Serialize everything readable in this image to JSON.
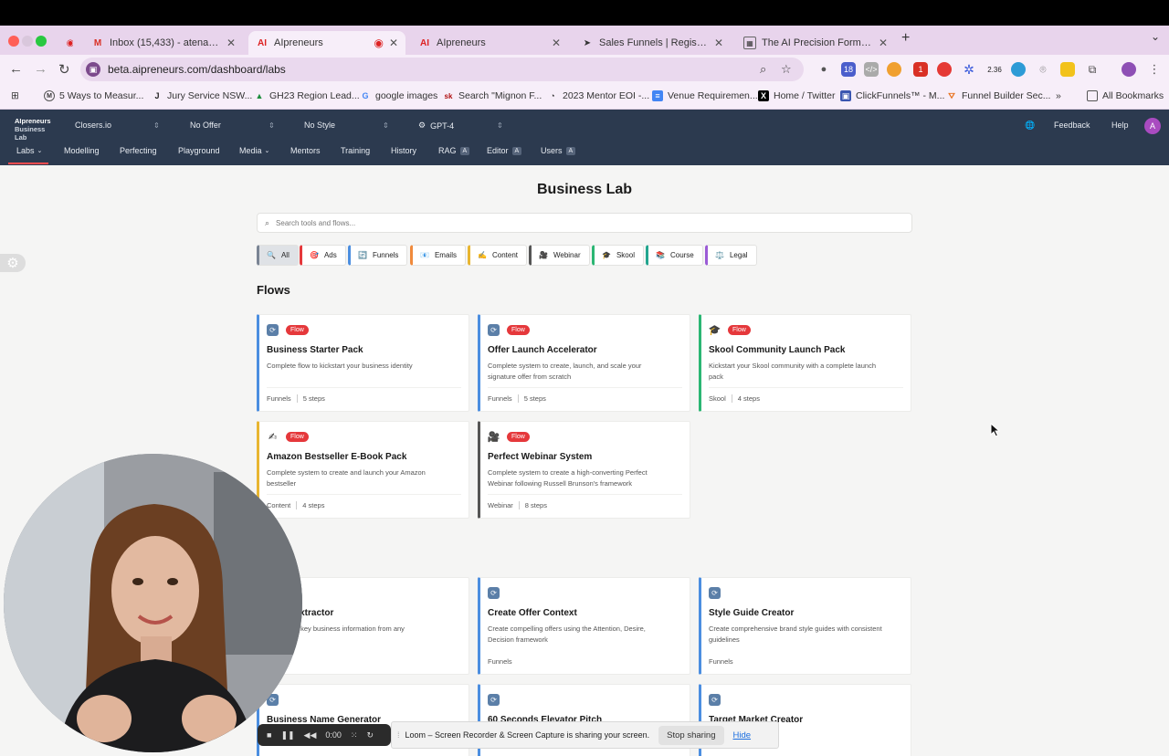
{
  "browser": {
    "tabs": [
      {
        "title": "Inbox (15,433) - atena@aten",
        "icon": "gmail-icon",
        "active": false
      },
      {
        "title": "AIpreneurs",
        "icon": "ai-icon",
        "active": true
      },
      {
        "title": "AIpreneurs",
        "icon": "ai-icon",
        "active": false
      },
      {
        "title": "Sales Funnels | Register For T",
        "icon": "cursor-icon",
        "active": false
      },
      {
        "title": "The AI Precision Formula - Fr",
        "icon": "page-icon",
        "active": false
      }
    ],
    "url": "beta.aipreneurs.com/dashboard/labs",
    "bookmarks": [
      "5 Ways to Measur...",
      "Jury Service NSW...",
      "GH23 Region Lead...",
      "google images",
      "Search \"Mignon F...",
      "2023 Mentor EOI -...",
      "Venue Requiremen...",
      "Home / Twitter",
      "ClickFunnels™ - M...",
      "Funnel Builder Sec..."
    ],
    "all_bookmarks": "All Bookmarks",
    "ext_badges": {
      "b1": "18",
      "b2": "1",
      "b3": "2.36"
    }
  },
  "app": {
    "logo_line1": "AIpreneurs",
    "logo_line2": "Business Lab",
    "selectors": [
      "Closers.io",
      "No Offer",
      "No Style",
      "GPT-4"
    ],
    "feedback": "Feedback",
    "help": "Help",
    "avatar": "A",
    "menu": [
      {
        "label": "Labs",
        "dropdown": true
      },
      {
        "label": "Modelling"
      },
      {
        "label": "Perfecting"
      },
      {
        "label": "Playground"
      },
      {
        "label": "Media",
        "dropdown": true
      },
      {
        "label": "Mentors"
      },
      {
        "label": "Training"
      },
      {
        "label": "History"
      },
      {
        "label": "RAG",
        "admin": "A"
      },
      {
        "label": "Editor",
        "admin": "A"
      },
      {
        "label": "Users",
        "admin": "A"
      }
    ]
  },
  "page": {
    "title": "Business Lab",
    "search_placeholder": "Search tools and flows...",
    "filters": [
      {
        "label": "All",
        "icon": "🔍",
        "color": "#7a8494"
      },
      {
        "label": "Ads",
        "icon": "🎯",
        "color": "#e5383b"
      },
      {
        "label": "Funnels",
        "icon": "🔄",
        "color": "#4b8ee0"
      },
      {
        "label": "Emails",
        "icon": "📧",
        "color": "#f08a3c"
      },
      {
        "label": "Content",
        "icon": "✍️",
        "color": "#e8b530"
      },
      {
        "label": "Webinar",
        "icon": "🎥",
        "color": "#555555"
      },
      {
        "label": "Skool",
        "icon": "🎓",
        "color": "#2bb673"
      },
      {
        "label": "Course",
        "icon": "📚",
        "color": "#23a58f"
      },
      {
        "label": "Legal",
        "icon": "⚖️",
        "color": "#9b5bd6"
      }
    ],
    "flows_heading": "Flows",
    "flow_badge": "Flow",
    "flows": [
      {
        "title": "Business Starter Pack",
        "desc": "Complete flow to kickstart your business identity",
        "category": "Funnels",
        "steps": "5 steps",
        "color": "#4b8ee0",
        "icon": "🔄"
      },
      {
        "title": "Offer Launch Accelerator",
        "desc": "Complete system to create, launch, and scale your signature offer from scratch",
        "category": "Funnels",
        "steps": "5 steps",
        "color": "#4b8ee0",
        "icon": "🔄"
      },
      {
        "title": "Skool Community Launch Pack",
        "desc": "Kickstart your Skool community with a complete launch pack",
        "category": "Skool",
        "steps": "4 steps",
        "color": "#2bb673",
        "icon": "🎓"
      },
      {
        "title": "Amazon Bestseller E-Book Pack",
        "desc": "Complete system to create and launch your Amazon bestseller",
        "category": "Content",
        "steps": "4 steps",
        "color": "#e8b530",
        "icon": "✍️"
      },
      {
        "title": "Perfect Webinar System",
        "desc": "Complete system to create a high-converting Perfect Webinar following Russell Brunson's framework",
        "category": "Webinar",
        "steps": "8 steps",
        "color": "#555555",
        "icon": "🎥"
      }
    ],
    "tools": [
      {
        "title": "s Info Extractor",
        "desc": "d organize key business information from any",
        "category": "",
        "color": "#4b8ee0"
      },
      {
        "title": "Create Offer Context",
        "desc": "Create compelling offers using the Attention, Desire, Decision framework",
        "category": "Funnels",
        "color": "#4b8ee0"
      },
      {
        "title": "Style Guide Creator",
        "desc": "Create comprehensive brand style guides with consistent guidelines",
        "category": "Funnels",
        "color": "#4b8ee0"
      },
      {
        "title": "Business Name Generator",
        "desc": "",
        "category": "",
        "color": "#4b8ee0"
      },
      {
        "title": "60 Seconds Elevator Pitch",
        "desc": "",
        "category": "",
        "color": "#4b8ee0"
      },
      {
        "title": "Target Market Creator",
        "desc": "",
        "category": "",
        "color": "#4b8ee0"
      }
    ]
  },
  "loom": {
    "timer": "0:00",
    "message": "Loom – Screen Recorder & Screen Capture is sharing your screen.",
    "stop": "Stop sharing",
    "hide": "Hide"
  }
}
